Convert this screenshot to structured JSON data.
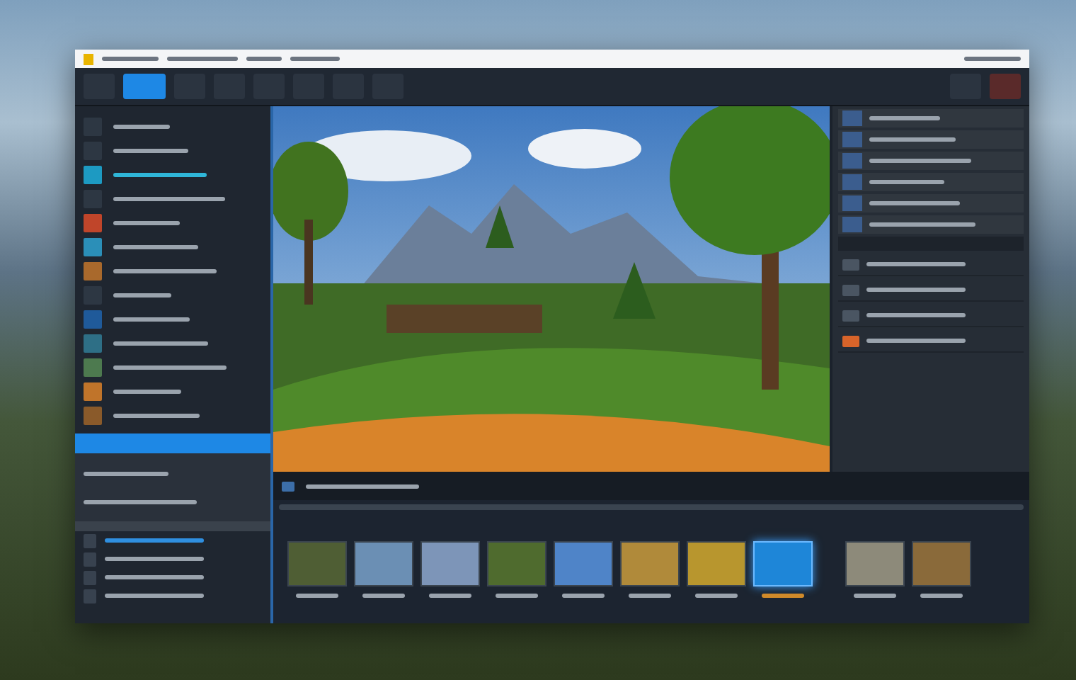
{
  "toolbar": {
    "buttons": [
      {
        "selected": false
      },
      {
        "selected": true
      },
      {
        "selected": false
      },
      {
        "selected": false
      },
      {
        "selected": false
      },
      {
        "selected": false
      },
      {
        "selected": false
      },
      {
        "selected": false
      }
    ]
  },
  "sidebar": {
    "items": [
      {
        "selected": false
      },
      {
        "selected": false
      },
      {
        "selected": true
      },
      {
        "selected": false
      },
      {
        "selected": false
      },
      {
        "selected": false
      },
      {
        "selected": false
      },
      {
        "selected": false
      },
      {
        "selected": false
      },
      {
        "selected": false
      },
      {
        "selected": false
      },
      {
        "selected": false
      },
      {
        "selected": false
      }
    ],
    "lower_items": [
      {
        "selected": true
      },
      {
        "selected": false
      },
      {
        "selected": false
      },
      {
        "selected": false
      }
    ]
  },
  "layers": [
    {
      "selected": false
    },
    {
      "selected": false
    },
    {
      "selected": false
    },
    {
      "selected": false
    },
    {
      "selected": false
    },
    {
      "selected": false
    }
  ],
  "filmstrip": {
    "thumbnails": [
      {
        "selected": false
      },
      {
        "selected": false
      },
      {
        "selected": false
      },
      {
        "selected": false
      },
      {
        "selected": false
      },
      {
        "selected": false
      },
      {
        "selected": false
      },
      {
        "selected": true
      },
      {
        "selected": false
      },
      {
        "selected": false
      }
    ]
  }
}
